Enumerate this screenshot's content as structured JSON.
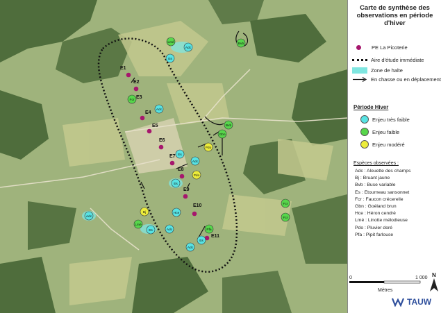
{
  "legend": {
    "title": "Carte de synthèse des observations en période d'hiver",
    "items": [
      {
        "label": "PE La Picoterie"
      },
      {
        "label": "Aire d'étude immédiate"
      },
      {
        "label": "Zone de halte"
      },
      {
        "label": "En chasse ou en déplacement"
      }
    ],
    "period_title": "Période Hiver",
    "enjeux": [
      {
        "label": "Enjeu très faible",
        "color": "#58e3e3"
      },
      {
        "label": "Enjeu faible",
        "color": "#57d64b"
      },
      {
        "label": "Enjeu modéré",
        "color": "#ecec3b"
      }
    ],
    "species_title": "Espèces observées :",
    "species": [
      "Adc : Alouette des champs",
      "Bj : Bruant jaune",
      "Bvb : Buse variable",
      "Es : Etourneau sansonnet",
      "Fcr : Faucon crécerelle",
      "Gbn : Goéland brun",
      "Hce : Héron cendré",
      "Lmé : Linotte mélodieuse",
      "Pdo : Pluvier doré",
      "Pfa : Pipit farlouse"
    ]
  },
  "scale": {
    "start": "0",
    "end": "1 000",
    "unit": "Mètres"
  },
  "north": "N",
  "logo": "TAUW",
  "map": {
    "turbines": [
      "E1",
      "E2",
      "E3",
      "E4",
      "E5",
      "E6",
      "E7",
      "E8",
      "E9",
      "E10",
      "E11"
    ],
    "markers": [
      {
        "code": "Lmé",
        "level": "faible"
      },
      {
        "code": "Adc",
        "level": "tres_faible"
      },
      {
        "code": "Es",
        "level": "tres_faible"
      },
      {
        "code": "Bvb",
        "level": "faible"
      },
      {
        "code": "Fcr",
        "level": "faible"
      },
      {
        "code": "Adc",
        "level": "tres_faible"
      },
      {
        "code": "Bvb",
        "level": "faible"
      },
      {
        "code": "Gbn",
        "level": "faible"
      },
      {
        "code": "Pdo",
        "level": "modere"
      },
      {
        "code": "Es",
        "level": "tres_faible"
      },
      {
        "code": "Adc",
        "level": "tres_faible"
      },
      {
        "code": "Pdo",
        "level": "modere"
      },
      {
        "code": "Es",
        "level": "tres_faible"
      },
      {
        "code": "Hce",
        "level": "tres_faible"
      },
      {
        "code": "Adc",
        "level": "tres_faible"
      },
      {
        "code": "Bj",
        "level": "modere"
      },
      {
        "code": "Lmé",
        "level": "faible"
      },
      {
        "code": "Es",
        "level": "tres_faible"
      },
      {
        "code": "Adc",
        "level": "tres_faible"
      },
      {
        "code": "Fcr",
        "level": "faible"
      },
      {
        "code": "Pfa",
        "level": "faible"
      },
      {
        "code": "Es",
        "level": "tres_faible"
      },
      {
        "code": "Adc",
        "level": "tres_faible"
      },
      {
        "code": "Fcr",
        "level": "faible"
      }
    ]
  }
}
